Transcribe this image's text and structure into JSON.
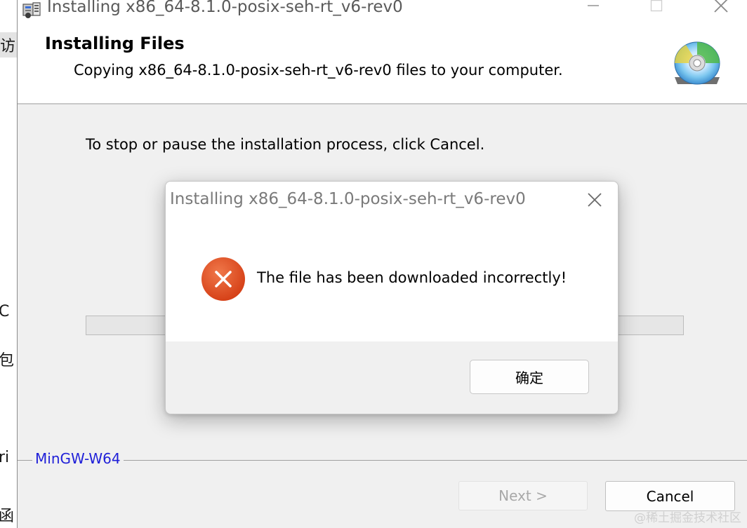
{
  "background_window": {
    "fragments": [
      "访问",
      "C",
      "包",
      "ri",
      "函"
    ]
  },
  "installer": {
    "title": "Installing x86_64-8.1.0-posix-seh-rt_v6-rev0",
    "header_title": "Installing Files",
    "header_subtitle": "Copying x86_64-8.1.0-posix-seh-rt_v6-rev0 files to your computer.",
    "instruction": "To stop or pause the installation process, click Cancel.",
    "progress": 0.0,
    "brand": "MinGW-W64",
    "next_label": "Next >",
    "cancel_label": "Cancel",
    "icons": {
      "app": "installer-icon",
      "header": "cd-disc-icon",
      "minimize": "minimize-icon",
      "maximize": "maximize-icon",
      "close": "close-icon"
    }
  },
  "dialog": {
    "title": "Installing x86_64-8.1.0-posix-seh-rt_v6-rev0",
    "message": "The file has been downloaded incorrectly!",
    "ok_label": "确定",
    "icon": "error-icon",
    "error_color": "#e04a1f"
  },
  "watermark": "@稀土掘金技术社区"
}
